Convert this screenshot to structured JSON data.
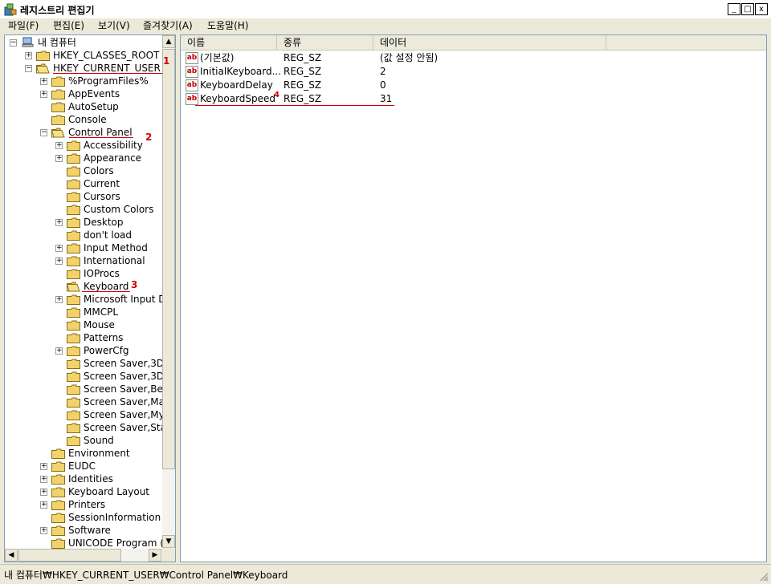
{
  "window": {
    "title": "레지스트리 편집기",
    "icon": "registry-editor-icon",
    "minimize_label": "_",
    "maximize_label": "□",
    "close_label": "x"
  },
  "menu": [
    {
      "label": "파일(F)",
      "key": "F"
    },
    {
      "label": "편집(E)",
      "key": "E"
    },
    {
      "label": "보기(V)",
      "key": "V"
    },
    {
      "label": "즐겨찾기(A)",
      "key": "A"
    },
    {
      "label": "도움말(H)",
      "key": "H"
    }
  ],
  "tree": [
    {
      "label": "내 컴퓨터",
      "level": 0,
      "expander": "minus",
      "icon": "computer-icon"
    },
    {
      "label": "HKEY_CLASSES_ROOT",
      "level": 1,
      "expander": "plus"
    },
    {
      "label": "HKEY_CURRENT_USER",
      "level": 1,
      "expander": "minus",
      "open": true
    },
    {
      "label": "%ProgramFiles%",
      "level": 2,
      "expander": "plus"
    },
    {
      "label": "AppEvents",
      "level": 2,
      "expander": "plus"
    },
    {
      "label": "AutoSetup",
      "level": 2,
      "expander": "none"
    },
    {
      "label": "Console",
      "level": 2,
      "expander": "none"
    },
    {
      "label": "Control Panel",
      "level": 2,
      "expander": "minus",
      "open": true
    },
    {
      "label": "Accessibility",
      "level": 3,
      "expander": "plus"
    },
    {
      "label": "Appearance",
      "level": 3,
      "expander": "plus"
    },
    {
      "label": "Colors",
      "level": 3,
      "expander": "none"
    },
    {
      "label": "Current",
      "level": 3,
      "expander": "none"
    },
    {
      "label": "Cursors",
      "level": 3,
      "expander": "none"
    },
    {
      "label": "Custom Colors",
      "level": 3,
      "expander": "none"
    },
    {
      "label": "Desktop",
      "level": 3,
      "expander": "plus"
    },
    {
      "label": "don't load",
      "level": 3,
      "expander": "none"
    },
    {
      "label": "Input Method",
      "level": 3,
      "expander": "plus"
    },
    {
      "label": "International",
      "level": 3,
      "expander": "plus"
    },
    {
      "label": "IOProcs",
      "level": 3,
      "expander": "none"
    },
    {
      "label": "Keyboard",
      "level": 3,
      "expander": "none",
      "open": true,
      "selected": true
    },
    {
      "label": "Microsoft Input D",
      "level": 3,
      "expander": "plus"
    },
    {
      "label": "MMCPL",
      "level": 3,
      "expander": "none"
    },
    {
      "label": "Mouse",
      "level": 3,
      "expander": "none"
    },
    {
      "label": "Patterns",
      "level": 3,
      "expander": "none"
    },
    {
      "label": "PowerCfg",
      "level": 3,
      "expander": "plus"
    },
    {
      "label": "Screen Saver,3D",
      "level": 3,
      "expander": "none"
    },
    {
      "label": "Screen Saver,3D",
      "level": 3,
      "expander": "none"
    },
    {
      "label": "Screen Saver,Be",
      "level": 3,
      "expander": "none"
    },
    {
      "label": "Screen Saver,Ma",
      "level": 3,
      "expander": "none"
    },
    {
      "label": "Screen Saver,My",
      "level": 3,
      "expander": "none"
    },
    {
      "label": "Screen Saver,Sta",
      "level": 3,
      "expander": "none"
    },
    {
      "label": "Sound",
      "level": 3,
      "expander": "none"
    },
    {
      "label": "Environment",
      "level": 2,
      "expander": "none"
    },
    {
      "label": "EUDC",
      "level": 2,
      "expander": "plus"
    },
    {
      "label": "Identities",
      "level": 2,
      "expander": "plus"
    },
    {
      "label": "Keyboard Layout",
      "level": 2,
      "expander": "plus"
    },
    {
      "label": "Printers",
      "level": 2,
      "expander": "plus"
    },
    {
      "label": "SessionInformation",
      "level": 2,
      "expander": "none"
    },
    {
      "label": "Software",
      "level": 2,
      "expander": "plus"
    },
    {
      "label": "UNICODE Program (",
      "level": 2,
      "expander": "none"
    }
  ],
  "columns": [
    "이름",
    "종류",
    "데이터"
  ],
  "values": [
    {
      "name": "(기본값)",
      "type": "REG_SZ",
      "data": "(값 설정 안됨)"
    },
    {
      "name": "InitialKeyboard...",
      "type": "REG_SZ",
      "data": "2"
    },
    {
      "name": "KeyboardDelay",
      "type": "REG_SZ",
      "data": "0"
    },
    {
      "name": "KeyboardSpeed",
      "type": "REG_SZ",
      "data": "31"
    }
  ],
  "annotations": [
    "1",
    "2",
    "3",
    "4"
  ],
  "annotation_color": "#d00000",
  "status": {
    "path": "내 컴퓨터₩HKEY_CURRENT_USER₩Control Panel₩Keyboard"
  }
}
